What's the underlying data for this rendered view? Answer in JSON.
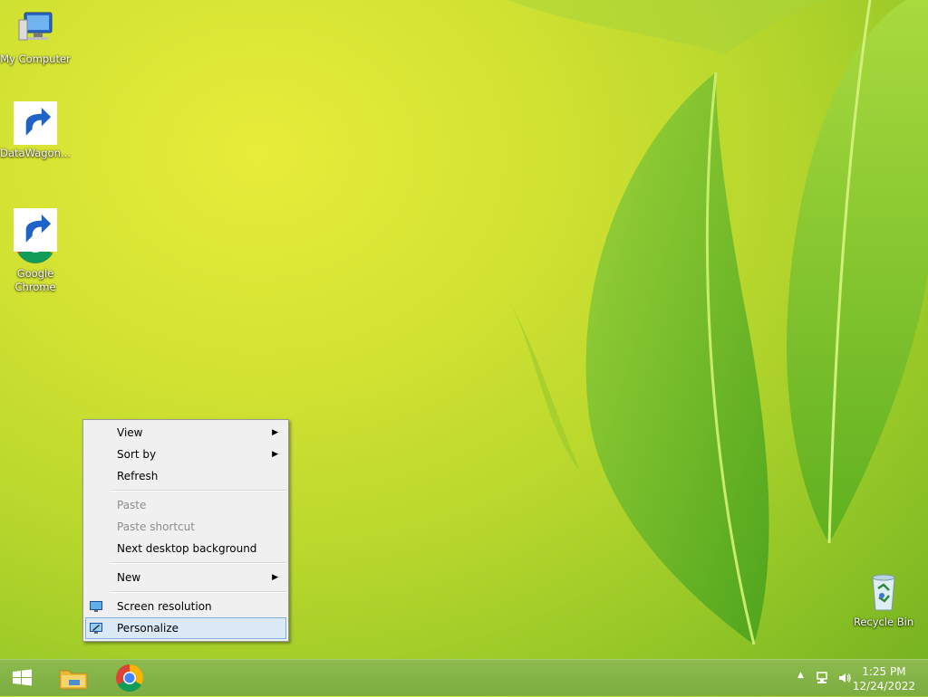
{
  "desktop": {
    "icons": [
      {
        "label": "My Computer"
      },
      {
        "label": "DataWagon..."
      },
      {
        "label": "Google\nChrome"
      },
      {
        "label": "Recycle Bin"
      }
    ]
  },
  "context_menu": {
    "items": [
      {
        "label": "View",
        "has_submenu": true
      },
      {
        "label": "Sort by",
        "has_submenu": true
      },
      {
        "label": "Refresh"
      },
      {
        "label": "Paste",
        "disabled": true
      },
      {
        "label": "Paste shortcut",
        "disabled": true
      },
      {
        "label": "Next desktop background"
      },
      {
        "label": "New",
        "has_submenu": true
      },
      {
        "label": "Screen resolution",
        "icon": "display-icon"
      },
      {
        "label": "Personalize",
        "icon": "personalize-icon",
        "highlighted": true
      }
    ]
  },
  "taskbar": {
    "pinned": [
      {
        "name": "File Explorer",
        "icon": "folder-icon"
      },
      {
        "name": "Google Chrome",
        "icon": "chrome-icon"
      }
    ],
    "tray": {
      "time": "1:25 PM",
      "date": "12/24/2022"
    }
  },
  "colors": {
    "menu_highlight": "#dbe9f7",
    "menu_highlight_border": "#7fb0e2",
    "taskbar": "#84b447"
  }
}
